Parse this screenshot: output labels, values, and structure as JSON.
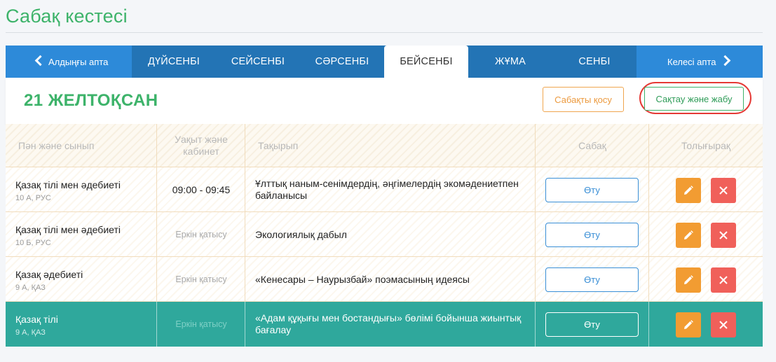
{
  "page": {
    "title": "Сабақ кестесі"
  },
  "week_nav": {
    "prev_label": "Алдыңғы апта",
    "next_label": "Келесі апта",
    "days": [
      {
        "label": "ДҮЙСЕНБІ",
        "active": false
      },
      {
        "label": "СЕЙСЕНБІ",
        "active": false
      },
      {
        "label": "СӘРСЕНБІ",
        "active": false
      },
      {
        "label": "БЕЙСЕНБІ",
        "active": true
      },
      {
        "label": "ЖҰМА",
        "active": false
      },
      {
        "label": "СЕНБІ",
        "active": false
      }
    ]
  },
  "day_header": {
    "date": "21 ЖЕЛТОҚСАН",
    "add_lesson_label": "Сабақты қосу",
    "save_close_label": "Сақтау және жабу"
  },
  "table": {
    "headers": {
      "subject": "Пән және сынып",
      "time": "Уақыт және кабинет",
      "topic": "Тақырып",
      "lesson": "Сабақ",
      "more": "Толығырақ"
    },
    "rows": [
      {
        "subject": "Қазақ тілі мен әдебиеті",
        "class": "10 А, РУС",
        "time": "09:00 - 09:45",
        "time_muted": false,
        "topic": "Ұлттық наным-сенімдердің, әңгімелердің экомәдениетпен байланысы",
        "go_label": "Өту",
        "selected": false
      },
      {
        "subject": "Қазақ тілі мен әдебиеті",
        "class": "10 Б, РУС",
        "time": "Еркін қатысу",
        "time_muted": true,
        "topic": "Экологиялық дабыл",
        "go_label": "Өту",
        "selected": false
      },
      {
        "subject": "Қазақ әдебиеті",
        "class": "9 А, ҚАЗ",
        "time": "Еркін қатысу",
        "time_muted": true,
        "topic": "«Кенесары – Наурызбай» поэмасының идеясы",
        "go_label": "Өту",
        "selected": false
      },
      {
        "subject": "Қазақ тілі",
        "class": "9 А, ҚАЗ",
        "time": "Еркін қатысу",
        "time_muted": true,
        "topic": "«Адам құқығы мен бостандығы» бөлімі бойынша жиынтық бағалау",
        "go_label": "Өту",
        "selected": true
      }
    ]
  },
  "colors": {
    "brand_green": "#3db36a",
    "nav_blue": "#2374b5",
    "nav_light_blue": "#2d8ad9",
    "accent_orange": "#f29c32",
    "danger_red": "#f0605a",
    "selected_teal": "#2fa89c",
    "highlight_ring": "#e53935"
  },
  "icons": {
    "prev": "chevron-left-icon",
    "next": "chevron-right-icon",
    "edit": "pencil-icon",
    "delete": "close-icon"
  }
}
